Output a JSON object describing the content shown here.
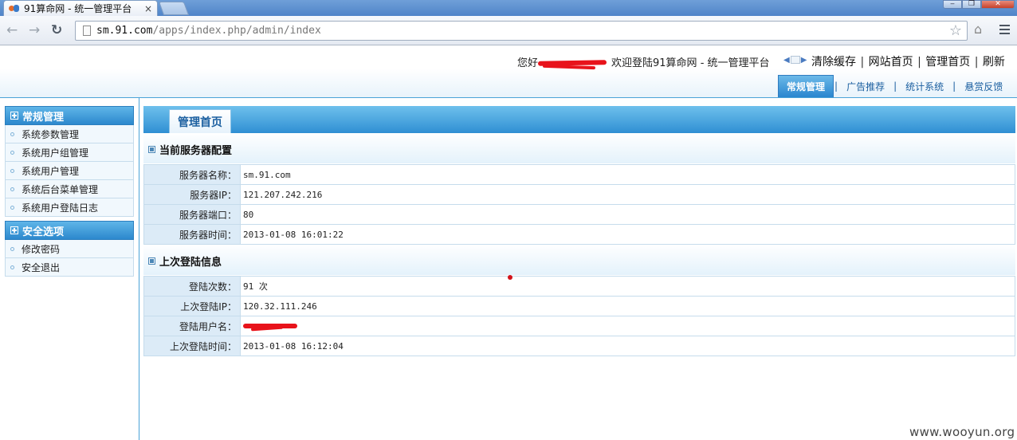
{
  "browser": {
    "tab_title": "91算命网 - 统一管理平台",
    "tab_close": "×",
    "url_host": "sm.91.com",
    "url_path": "/apps/index.php/admin/index",
    "back_glyph": "←",
    "forward_glyph": "→",
    "reload_glyph": "↻",
    "star_glyph": "☆",
    "min_glyph": "‒",
    "max_glyph": "❐",
    "close_glyph": "✕"
  },
  "header": {
    "hello": "您好",
    "welcome": "欢迎登陆91算命网 - 统一管理平台",
    "arrow_left": "◀",
    "arrow_right": "▶",
    "links": [
      "清除缓存",
      "网站首页",
      "管理首页",
      "刷新"
    ],
    "nav_tabs": [
      "常规管理",
      "广告推荐",
      "统计系统",
      "悬赏反馈"
    ],
    "active_tab_index": 0
  },
  "sidebar": {
    "groups": [
      {
        "title": "常规管理",
        "items": [
          "系统参数管理",
          "系统用户组管理",
          "系统用户管理",
          "系统后台菜单管理",
          "系统用户登陆日志"
        ]
      },
      {
        "title": "安全选项",
        "items": [
          "修改密码",
          "安全退出"
        ]
      }
    ]
  },
  "main": {
    "tab_label": "管理首页",
    "server_section": {
      "title": "当前服务器配置",
      "rows": [
        {
          "label": "服务器名称：",
          "value": "sm.91.com"
        },
        {
          "label": "服务器IP：",
          "value": "121.207.242.216"
        },
        {
          "label": "服务器端口：",
          "value": "80"
        },
        {
          "label": "服务器时间：",
          "value": "2013-01-08 16:01:22"
        }
      ]
    },
    "login_section": {
      "title": "上次登陆信息",
      "rows": [
        {
          "label": "登陆次数：",
          "value": "91 次"
        },
        {
          "label": "上次登陆IP：",
          "value": "120.32.111.246"
        },
        {
          "label": "登陆用户名：",
          "value": ""
        },
        {
          "label": "上次登陆时间：",
          "value": "2013-01-08 16:12:04"
        }
      ]
    }
  },
  "watermark": "www.wooyun.org"
}
